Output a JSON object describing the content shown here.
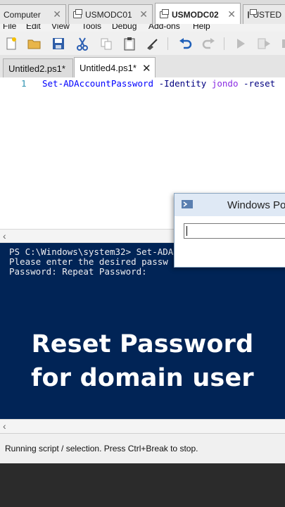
{
  "remote_tabs": [
    {
      "label": "Computer",
      "active": false
    },
    {
      "label": "USMODC01",
      "active": false
    },
    {
      "label": "USMODC02",
      "active": true
    },
    {
      "label": "USTED",
      "active": false
    }
  ],
  "menu": [
    "File",
    "Edit",
    "View",
    "Tools",
    "Debug",
    "Add-ons",
    "Help"
  ],
  "toolbar_icons": [
    "new-file-icon",
    "open-folder-icon",
    "save-icon",
    "cut-icon",
    "copy-icon",
    "paste-icon",
    "clear-icon",
    "undo-icon",
    "redo-icon",
    "run-icon",
    "run-selection-icon",
    "stop-icon"
  ],
  "editor_tabs": [
    {
      "label": "Untitled2.ps1*",
      "active": false
    },
    {
      "label": "Untitled4.ps1*",
      "active": true,
      "close": "✕"
    }
  ],
  "editor": {
    "line_number": "1",
    "tokens": {
      "cmd": "Set-ADAccountPassword",
      "p1": "-Identity",
      "v1": "jondo",
      "p2": "-reset"
    }
  },
  "console": {
    "lines": [
      "PS C:\\Windows\\system32> Set-ADA",
      "Please enter the desired passw",
      "Password: Repeat Password:"
    ]
  },
  "overlay": {
    "line1": "Reset Password",
    "line2": "for domain user"
  },
  "status": "Running script / selection.  Press Ctrl+Break to stop.",
  "dialog": {
    "title": "Windows Po",
    "input_value": ""
  },
  "colors": {
    "console_bg": "#012456",
    "console_fg": "#eeedf0",
    "accent": "#0000ff"
  }
}
